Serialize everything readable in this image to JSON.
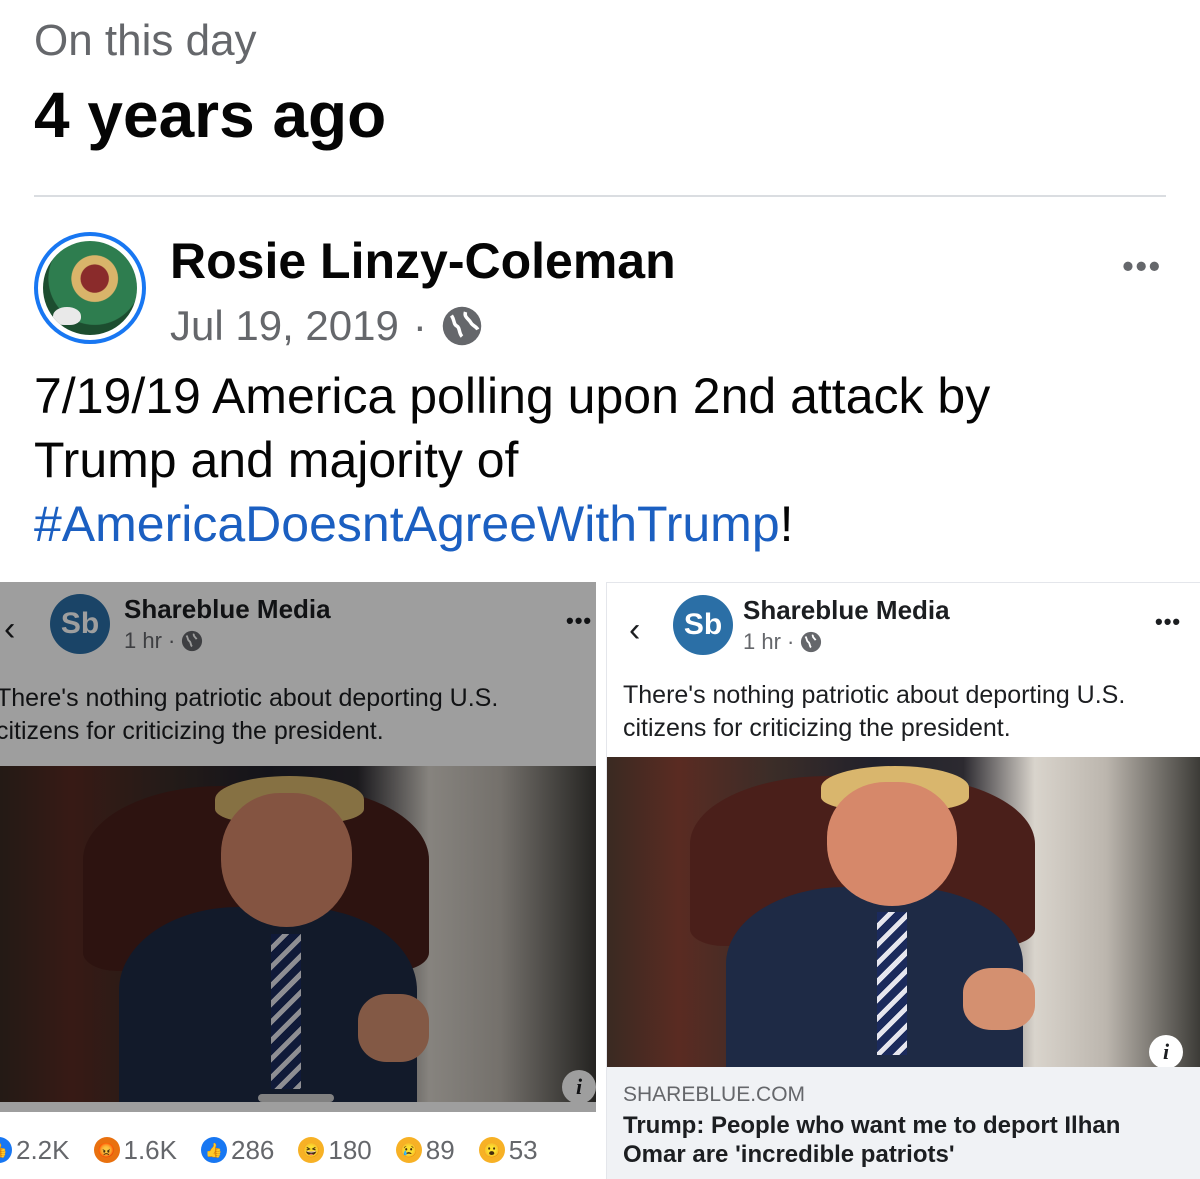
{
  "memory": {
    "label": "On this day",
    "years": "4 years ago"
  },
  "post": {
    "author": "Rosie Linzy-Coleman",
    "date": "Jul 19, 2019",
    "separator": "·",
    "privacy_icon": "globe-icon",
    "text_line1": "7/19/19 America polling upon 2nd attack by",
    "text_line2": "Trump and majority of",
    "hashtag": "#AmericaDoesntAgreeWithTrump",
    "text_end": "!"
  },
  "shared_left": {
    "back": "‹",
    "page_name": "Shareblue Media",
    "logo_text": "Sb",
    "time": "1 hr ·",
    "more": "•••",
    "text_line1": "There's nothing patriotic about deporting U.S.",
    "text_line2": "citizens for criticizing the president.",
    "info": "i"
  },
  "shared_right": {
    "back": "‹",
    "page_name": "Shareblue Media",
    "logo_text": "Sb",
    "time": "1 hr ·",
    "more": "•••",
    "text_line1": "There's nothing patriotic about deporting U.S.",
    "text_line2": "citizens for criticizing the president.",
    "info": "i",
    "link_domain": "SHAREBLUE.COM",
    "link_title_line1": "Trump: People who want me to deport Ilhan",
    "link_title_line2": "Omar are 'incredible patriots'"
  },
  "reactions": [
    {
      "icon": "like-icon",
      "count": "2.2K",
      "color": "#1877f2"
    },
    {
      "icon": "angry-icon",
      "count": "1.6K",
      "color": "#e9710f"
    },
    {
      "icon": "like-icon",
      "count": "286",
      "color": "#1877f2"
    },
    {
      "icon": "haha-icon",
      "count": "180",
      "color": "#f7b125"
    },
    {
      "icon": "sad-icon",
      "count": "89",
      "color": "#f7b125"
    },
    {
      "icon": "wow-icon",
      "count": "53",
      "color": "#f7b125"
    }
  ],
  "colors": {
    "accent": "#1877f2",
    "hashtag": "#1b5fc1",
    "muted": "#65676b",
    "shareblue": "#2b6fa6"
  }
}
